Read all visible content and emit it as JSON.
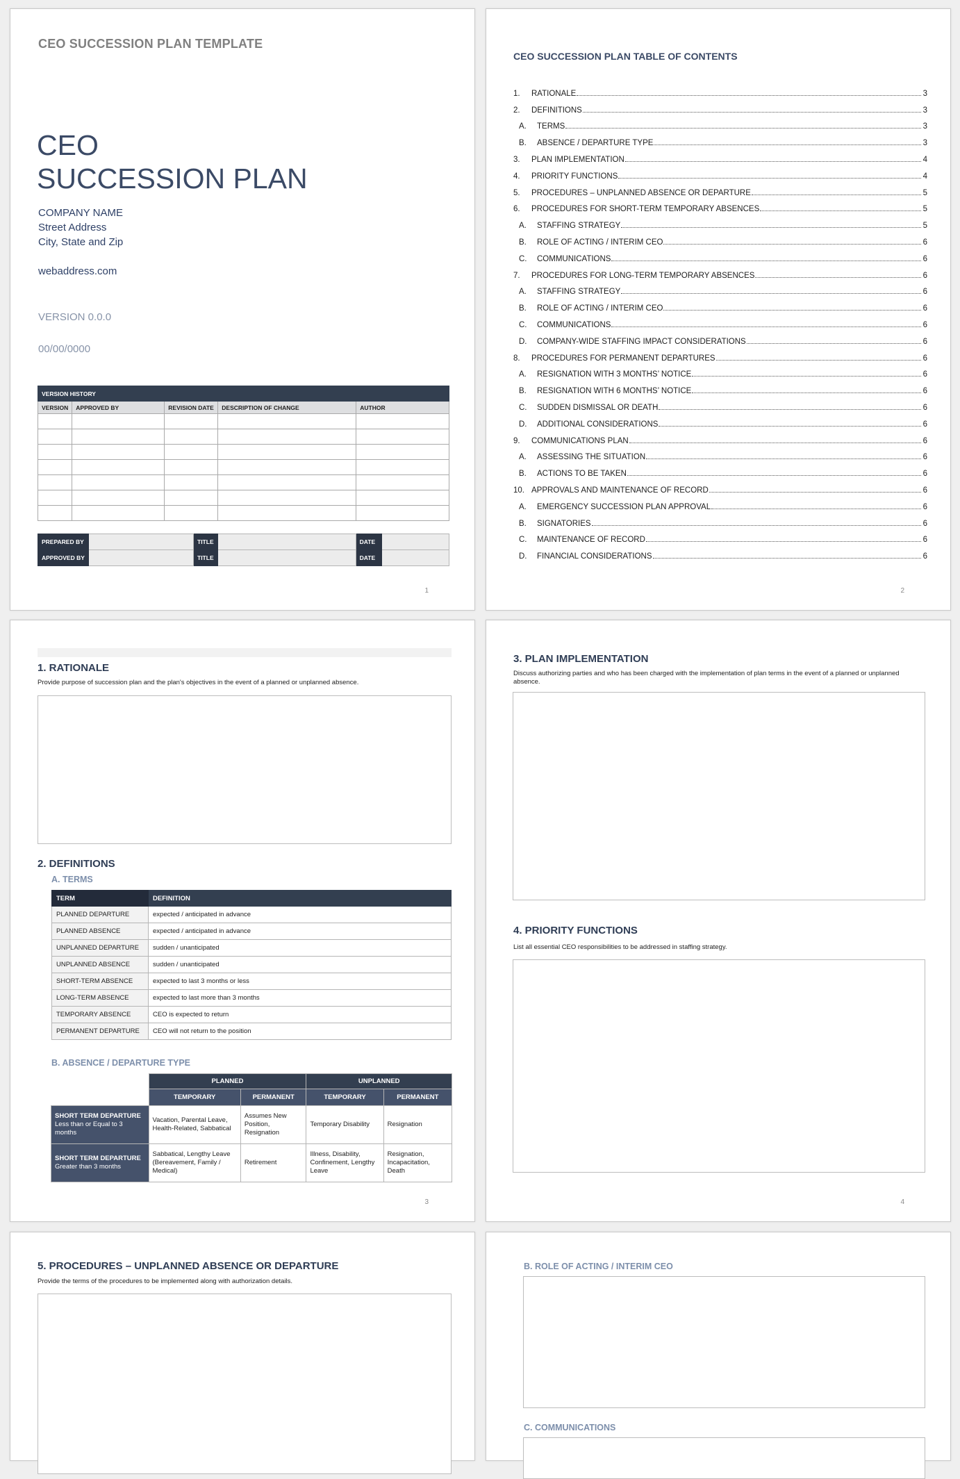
{
  "colors": {
    "heading": "#2f3d55",
    "subheading": "#7d8fab",
    "table_dark": "#333f50",
    "table_mid": "#45526b",
    "page_bg": "#efefef"
  },
  "page1": {
    "kicker": "CEO SUCCESSION PLAN TEMPLATE",
    "title_line1": "CEO",
    "title_line2": "SUCCESSION PLAN",
    "company_name": "COMPANY NAME",
    "street": "Street Address",
    "city": "City, State and Zip",
    "web": "webaddress.com",
    "version": "VERSION 0.0.0",
    "date": "00/00/0000",
    "version_history": {
      "title": "VERSION HISTORY",
      "columns": [
        "VERSION",
        "APPROVED BY",
        "REVISION DATE",
        "DESCRIPTION OF CHANGE",
        "AUTHOR"
      ],
      "empty_rows": 7
    },
    "signoff": {
      "prepared_by": "PREPARED BY",
      "approved_by": "APPROVED BY",
      "title": "TITLE",
      "date": "DATE"
    },
    "page_number": "1"
  },
  "page2": {
    "toc_title": "CEO SUCCESSION PLAN TABLE OF CONTENTS",
    "toc": [
      {
        "num": "1.",
        "label": "RATIONALE",
        "page": "3",
        "sub": false
      },
      {
        "num": "2.",
        "label": "DEFINITIONS",
        "page": "3",
        "sub": false
      },
      {
        "num": "A.",
        "label": "TERMS",
        "page": "3",
        "sub": true
      },
      {
        "num": "B.",
        "label": "ABSENCE / DEPARTURE TYPE",
        "page": "3",
        "sub": true
      },
      {
        "num": "3.",
        "label": "PLAN IMPLEMENTATION",
        "page": "4",
        "sub": false
      },
      {
        "num": "4.",
        "label": "PRIORITY FUNCTIONS",
        "page": "4",
        "sub": false
      },
      {
        "num": "5.",
        "label": "PROCEDURES – UNPLANNED ABSENCE OR DEPARTURE",
        "page": "5",
        "sub": false
      },
      {
        "num": "6.",
        "label": "PROCEDURES FOR SHORT-TERM TEMPORARY ABSENCES",
        "page": "5",
        "sub": false
      },
      {
        "num": "A.",
        "label": "STAFFING STRATEGY",
        "page": "5",
        "sub": true
      },
      {
        "num": "B.",
        "label": "ROLE OF ACTING / INTERIM CEO",
        "page": "6",
        "sub": true
      },
      {
        "num": "C.",
        "label": "COMMUNICATIONS",
        "page": "6",
        "sub": true
      },
      {
        "num": "7.",
        "label": "PROCEDURES FOR LONG-TERM TEMPORARY ABSENCES",
        "page": "6",
        "sub": false
      },
      {
        "num": "A.",
        "label": "STAFFING STRATEGY",
        "page": "6",
        "sub": true
      },
      {
        "num": "B.",
        "label": "ROLE OF ACTING / INTERIM CEO",
        "page": "6",
        "sub": true
      },
      {
        "num": "C.",
        "label": "COMMUNICATIONS",
        "page": "6",
        "sub": true
      },
      {
        "num": "D.",
        "label": "COMPANY-WIDE STAFFING IMPACT CONSIDERATIONS",
        "page": "6",
        "sub": true
      },
      {
        "num": "8.",
        "label": "PROCEDURES FOR PERMANENT DEPARTURES",
        "page": "6",
        "sub": false
      },
      {
        "num": "A.",
        "label": "RESIGNATION WITH 3 MONTHS’ NOTICE",
        "page": "6",
        "sub": true
      },
      {
        "num": "B.",
        "label": "RESIGNATION WITH 6 MONTHS’ NOTICE",
        "page": "6",
        "sub": true
      },
      {
        "num": "C.",
        "label": "SUDDEN DISMISSAL OR DEATH",
        "page": "6",
        "sub": true
      },
      {
        "num": "D.",
        "label": "ADDITIONAL CONSIDERATIONS",
        "page": "6",
        "sub": true
      },
      {
        "num": "9.",
        "label": "COMMUNICATIONS PLAN",
        "page": "6",
        "sub": false
      },
      {
        "num": "A.",
        "label": "ASSESSING THE SITUATION",
        "page": "6",
        "sub": true
      },
      {
        "num": "B.",
        "label": "ACTIONS TO BE TAKEN",
        "page": "6",
        "sub": true
      },
      {
        "num": "10.",
        "label": "APPROVALS AND MAINTENANCE OF RECORD",
        "page": "6",
        "sub": false
      },
      {
        "num": "A.",
        "label": "EMERGENCY SUCCESSION PLAN APPROVAL",
        "page": "6",
        "sub": true
      },
      {
        "num": "B.",
        "label": "SIGNATORIES",
        "page": "6",
        "sub": true
      },
      {
        "num": "C.",
        "label": "MAINTENANCE OF RECORD",
        "page": "6",
        "sub": true
      },
      {
        "num": "D.",
        "label": "FINANCIAL CONSIDERATIONS",
        "page": "6",
        "sub": true
      }
    ],
    "page_number": "2"
  },
  "page3": {
    "rationale_heading": "1.  RATIONALE",
    "rationale_desc": "Provide purpose of succession plan and the plan's objectives in the event of a planned or unplanned absence.",
    "definitions_heading": "2.  DEFINITIONS",
    "terms_heading": "A.  TERMS",
    "terms_columns": [
      "TERM",
      "DEFINITION"
    ],
    "terms": [
      {
        "term": "PLANNED DEPARTURE",
        "definition": "expected / anticipated in advance"
      },
      {
        "term": "PLANNED ABSENCE",
        "definition": "expected / anticipated in advance"
      },
      {
        "term": "UNPLANNED DEPARTURE",
        "definition": "sudden / unanticipated"
      },
      {
        "term": "UNPLANNED ABSENCE",
        "definition": "sudden / unanticipated"
      },
      {
        "term": "SHORT-TERM ABSENCE",
        "definition": "expected to last 3 months or less"
      },
      {
        "term": "LONG-TERM ABSENCE",
        "definition": "expected to last more than 3 months"
      },
      {
        "term": "TEMPORARY ABSENCE",
        "definition": "CEO is expected to return"
      },
      {
        "term": "PERMANENT DEPARTURE",
        "definition": "CEO will not return to the position"
      }
    ],
    "absence_heading": "B.  ABSENCE / DEPARTURE TYPE",
    "absence_table": {
      "groups": [
        "PLANNED",
        "UNPLANNED"
      ],
      "subcolumns": [
        "TEMPORARY",
        "PERMANENT",
        "TEMPORARY",
        "PERMANENT"
      ],
      "rows": [
        {
          "title": "SHORT TERM DEPARTURE",
          "subtitle": "Less than or Equal to 3 months",
          "cells": [
            "Vacation, Parental Leave, Health-Related, Sabbatical",
            "Assumes New Position, Resignation",
            "Temporary Disability",
            "Resignation"
          ]
        },
        {
          "title": "SHORT TERM DEPARTURE",
          "subtitle": "Greater than 3 months",
          "cells": [
            "Sabbatical, Lengthy Leave (Bereavement, Family / Medical)",
            "Retirement",
            "Illness, Disability, Confinement, Lengthy Leave",
            "Resignation, Incapacitation, Death"
          ]
        }
      ]
    },
    "page_number": "3"
  },
  "page4": {
    "plan_heading": "3.  PLAN IMPLEMENTATION",
    "plan_desc": "Discuss authorizing parties and who has been charged with the implementation of plan terms in the event of a planned or unplanned absence.",
    "priority_heading": "4.  PRIORITY FUNCTIONS",
    "priority_desc": "List all essential CEO responsibilities to be addressed in staffing strategy.",
    "page_number": "4"
  },
  "page5": {
    "procedures_heading": "5.  PROCEDURES – UNPLANNED ABSENCE OR DEPARTURE",
    "procedures_desc": "Provide the terms of the procedures to be implemented along with authorization details."
  },
  "page6": {
    "role_heading": "B.  ROLE OF ACTING / INTERIM CEO",
    "comms_heading": "C.  COMMUNICATIONS"
  }
}
